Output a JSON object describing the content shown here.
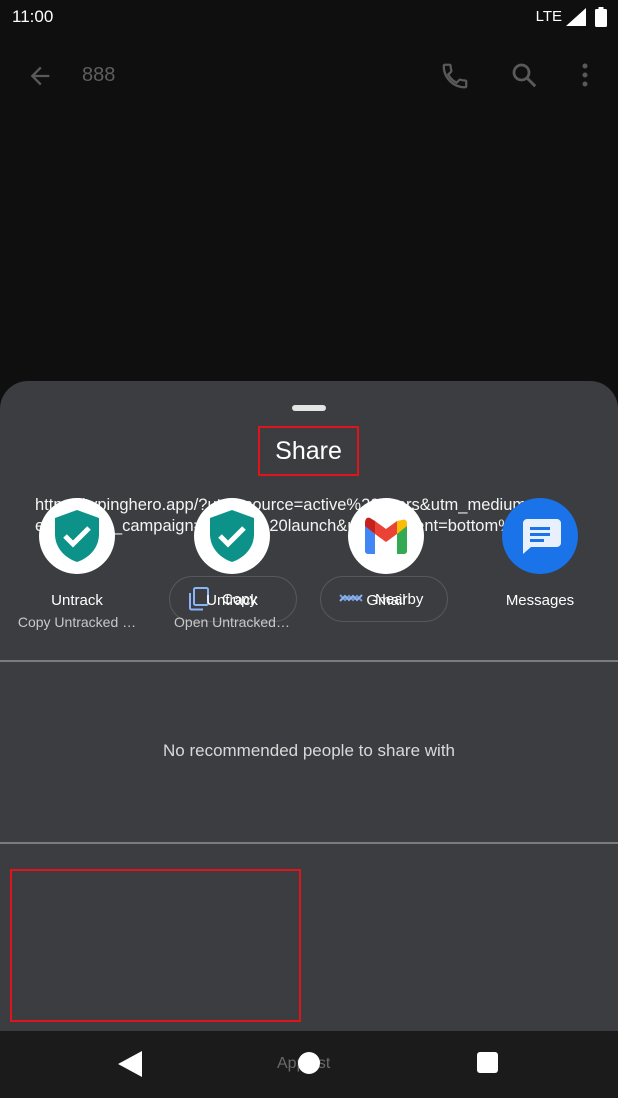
{
  "status_bar": {
    "time": "11:00",
    "network": "LTE"
  },
  "app_bar": {
    "title": "888",
    "icons": [
      "back-arrow-icon",
      "phone-icon",
      "search-icon",
      "more-vert-icon"
    ]
  },
  "share_sheet": {
    "title": "Share",
    "url_line1": "https://typinghero.app/?utm_source=active%20users&utm_medium=",
    "url_line2": "email&utm_campaign=feature%20launch&utm_content=bottom%20ct…",
    "actions": [
      {
        "label": "Copy",
        "icon": "copy-icon"
      },
      {
        "label": "Nearby",
        "icon": "nearby-icon"
      }
    ],
    "no_recommendations": "No recommended people to share with",
    "apps": [
      {
        "name": "Untrack",
        "subtitle": "Copy Untracked …",
        "icon": "shield-check-icon"
      },
      {
        "name": "Untrack",
        "subtitle": "Open Untracked…",
        "icon": "shield-check-icon"
      },
      {
        "name": "Gmail",
        "subtitle": "",
        "icon": "gmail-icon"
      },
      {
        "name": "Messages",
        "subtitle": "",
        "icon": "messages-icon"
      }
    ]
  },
  "nav_bar": {
    "applist_label": "AppList"
  },
  "colors": {
    "highlight": "#e0141b",
    "sheet_bg": "#3b3d40",
    "untrack_teal": "#0c9288",
    "messages_blue": "#1a73e8"
  }
}
